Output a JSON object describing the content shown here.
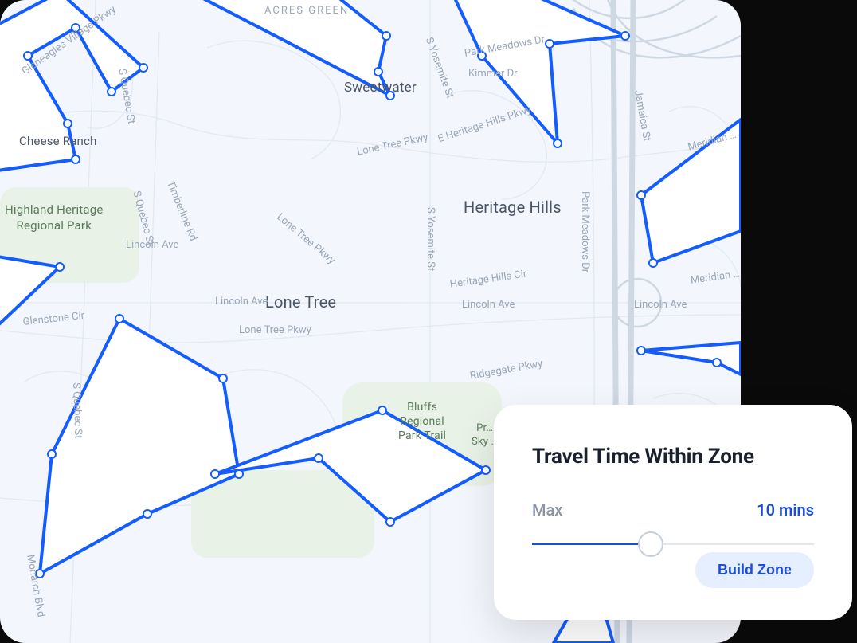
{
  "map": {
    "neighborhoods": {
      "acres_green": "ACRES GREEN",
      "heritage_hills": "Heritage Hills",
      "lone_tree": "Lone Tree",
      "sweetwater": "Sweetwater",
      "cheese_ranch": "Cheese Ranch"
    },
    "parks": {
      "highland": "Highland Heritage\nRegional Park",
      "bluffs": "Bluffs\nRegional\nPark Trail",
      "prairie_sky": "Pr…\nSky …"
    },
    "roads": {
      "gleneagles": "Gleneagles Village Pkwy",
      "s_quebec_1": "S Quebec St",
      "s_quebec_2": "S Quebec St",
      "s_quebec_3": "S Quebec St",
      "timberline": "Timberline Rd",
      "lincoln_1": "Lincoln Ave",
      "lincoln_2": "Lincoln Ave",
      "lincoln_3": "Lincoln Ave",
      "lincoln_4": "Lincoln Ave",
      "lone_tree_pkwy_1": "Lone Tree Pkwy",
      "lone_tree_pkwy_2": "Lone Tree Pkwy",
      "lone_tree_pkwy_3": "Lone Tree Pkwy",
      "s_yosemite_1": "S Yosemite St",
      "s_yosemite_2": "S Yosemite St",
      "park_meadows_1": "Park Meadows Dr",
      "park_meadows_2": "Park Meadows Dr",
      "kimmer": "Kimmer Dr",
      "e_heritage": "E Heritage Hills Pkwy",
      "heritage_cir": "Heritage Hills Cir",
      "ridgegate": "Ridgegate Pkwy",
      "glenstone": "Glenstone Cir",
      "monarch": "Monarch Blvd",
      "jamaica": "Jamaica St",
      "meridian_1": "Meridian …",
      "meridian_2": "Meridian …"
    }
  },
  "panel": {
    "title": "Travel Time Within Zone",
    "slider_label": "Max",
    "slider_value": "10 mins",
    "slider_percent": 42,
    "build_button": "Build Zone"
  }
}
